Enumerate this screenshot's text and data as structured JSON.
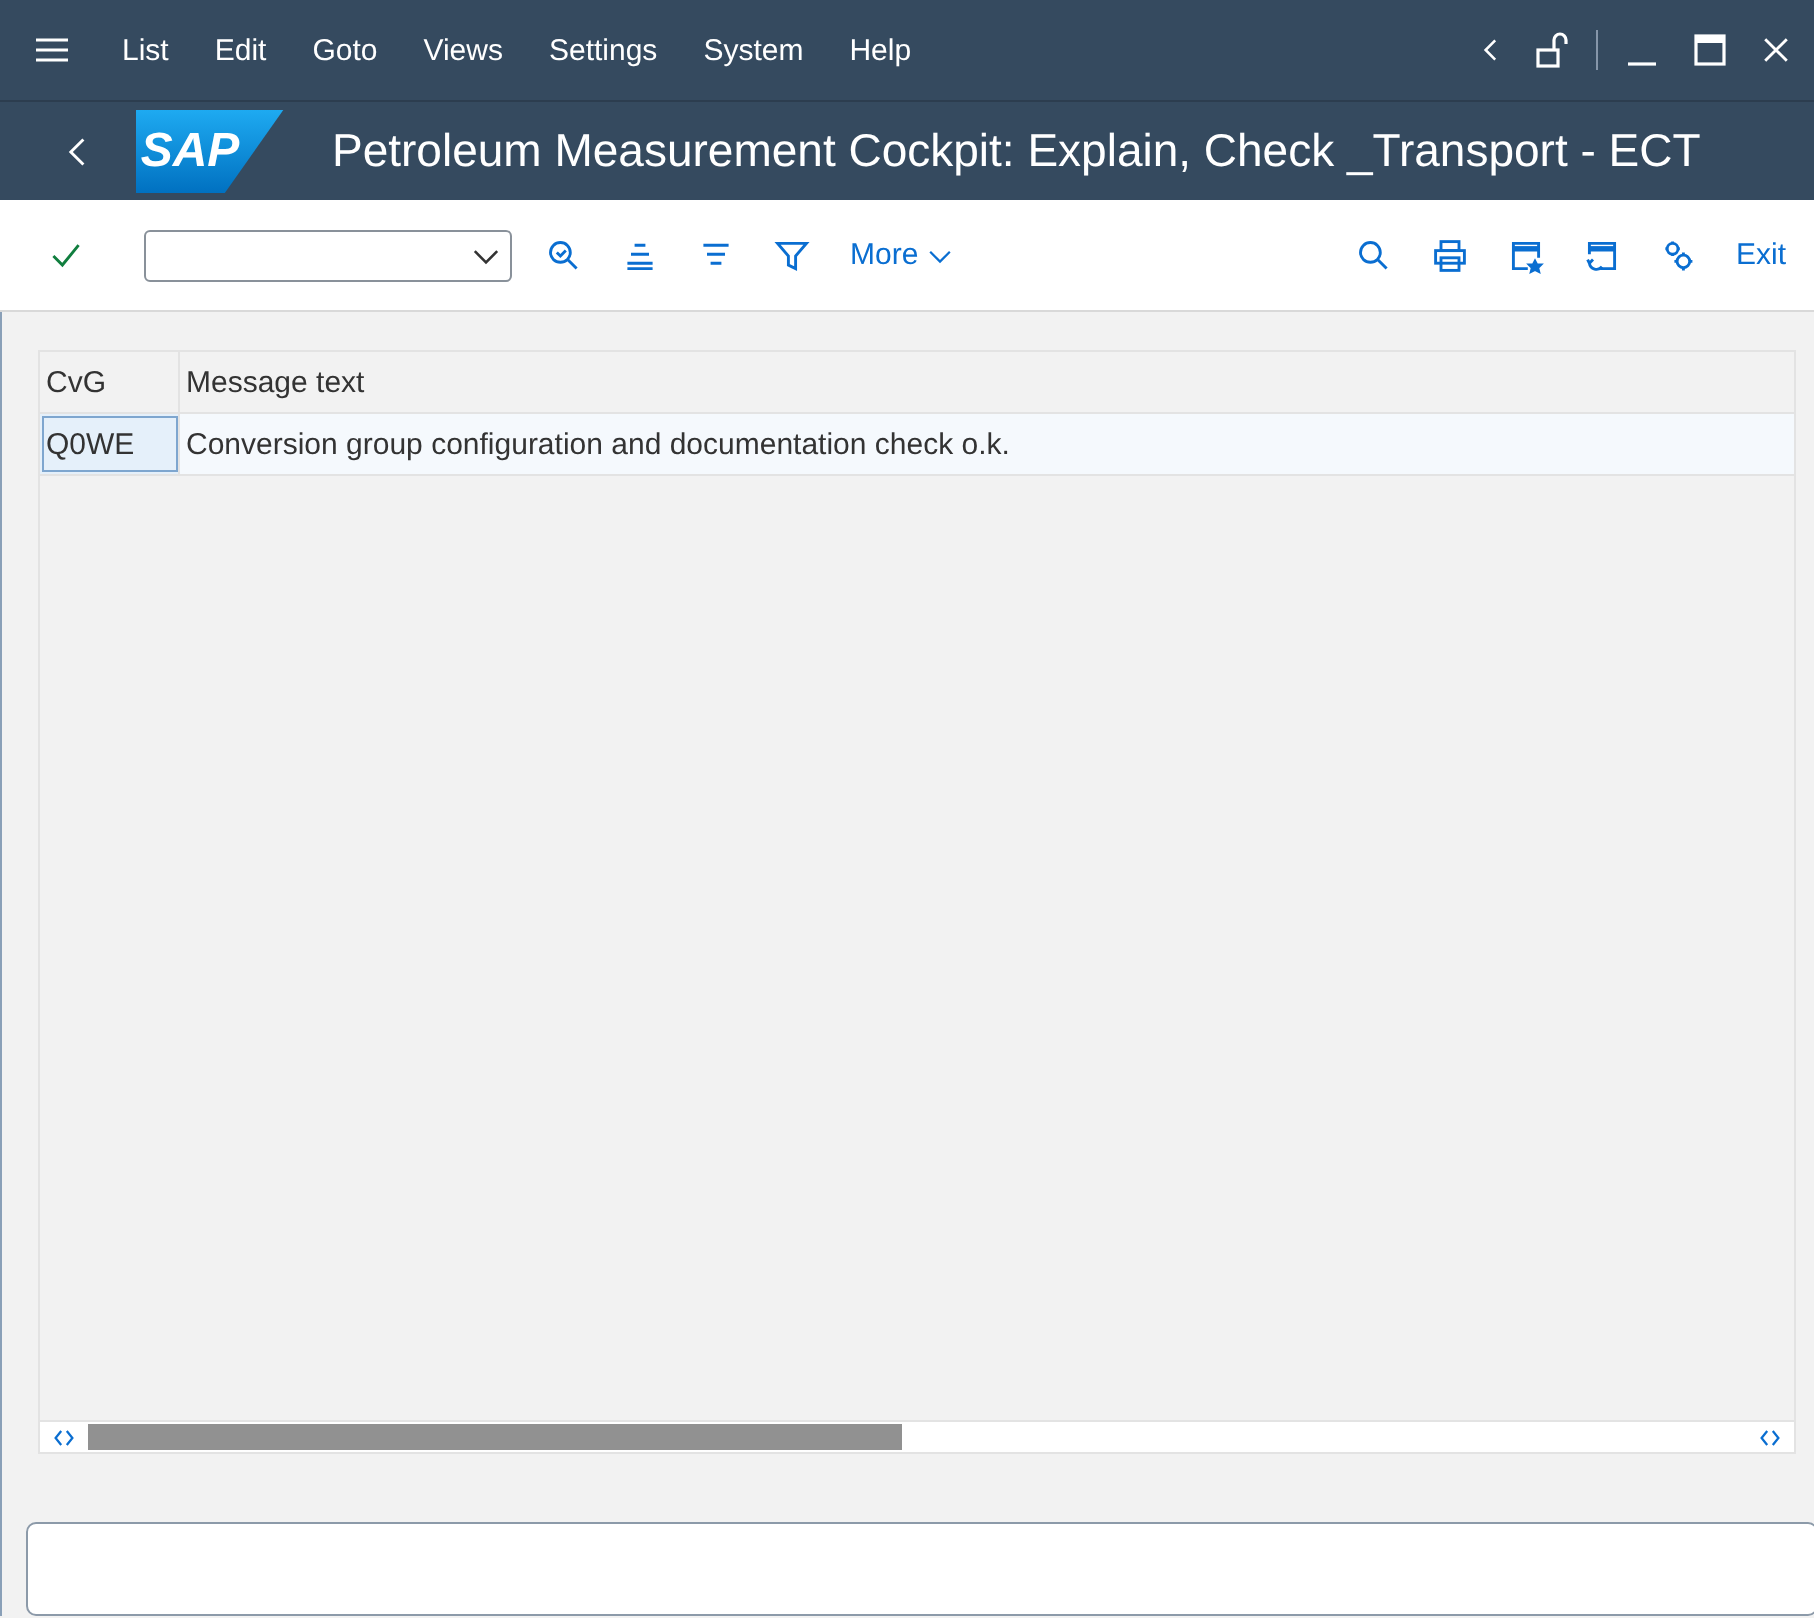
{
  "menu_bar": {
    "items": [
      {
        "label": "List"
      },
      {
        "label": "Edit"
      },
      {
        "label": "Goto"
      },
      {
        "label": "Views"
      },
      {
        "label": "Settings"
      },
      {
        "label": "System"
      },
      {
        "label": "Help"
      }
    ]
  },
  "title_bar": {
    "logo": "SAP",
    "title": "Petroleum Measurement Cockpit: Explain, Check _Transport - ECT"
  },
  "toolbar": {
    "more": "More",
    "exit": "Exit"
  },
  "table": {
    "columns": [
      "CvG",
      "Message text"
    ],
    "rows": [
      {
        "selected": true,
        "cells": [
          {
            "text": "Q0WE",
            "selected": true
          },
          {
            "text": "Conversion group configuration and documentation check o.k.",
            "selected": false
          }
        ]
      }
    ]
  }
}
